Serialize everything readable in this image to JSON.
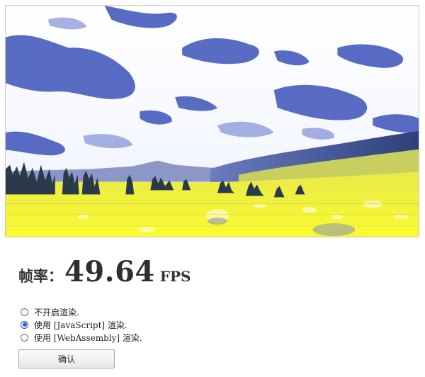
{
  "fps": {
    "label": "帧率：",
    "value": "49.64",
    "unit": "FPS"
  },
  "render_modes": {
    "options": [
      {
        "label": "不开启渲染.",
        "checked": false
      },
      {
        "label": "使用 [JavaScript] 渲染.",
        "checked": true
      },
      {
        "label": "使用 [WebAssembly] 渲染.",
        "checked": false
      }
    ]
  },
  "confirm_button": {
    "label": "确认"
  },
  "colors": {
    "accent": "#3a58d6",
    "sky": "#ffffff",
    "clouds": "#4a5fc0",
    "meadow": "#f2f23a",
    "hills": "#3a4a8a"
  },
  "icons": [
    "radio-unchecked-icon",
    "radio-checked-icon"
  ]
}
